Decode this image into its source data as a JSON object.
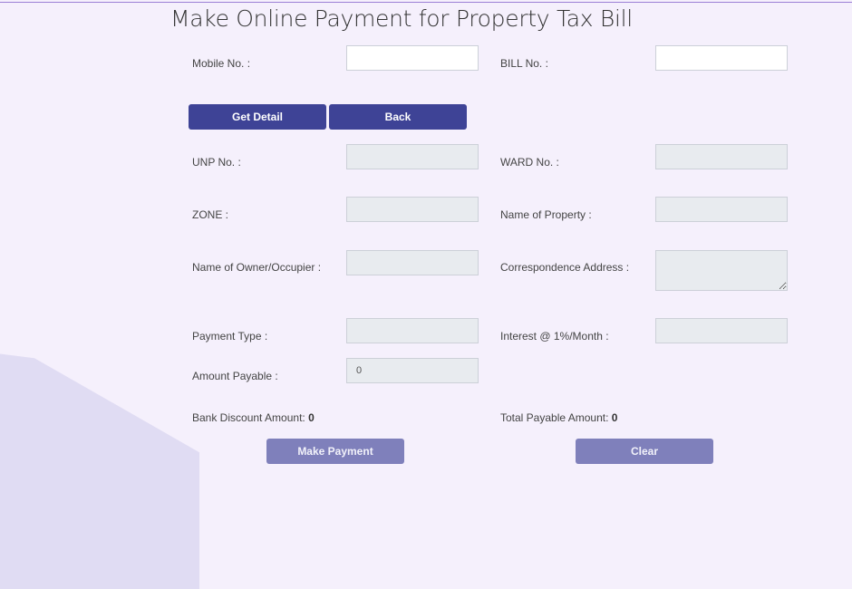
{
  "page": {
    "title": "Make Online Payment for Property Tax Bill"
  },
  "search": {
    "mobile_label": "Mobile No. :",
    "mobile_value": "",
    "bill_label": "BILL No. :",
    "bill_value": "",
    "get_detail_label": "Get Detail",
    "back_label": "Back"
  },
  "details": {
    "unp_label": "UNP No. :",
    "ward_label": "WARD No. :",
    "zone_label": "ZONE :",
    "property_name_label": "Name of Property :",
    "owner_label": "Name of Owner/Occupier :",
    "address_label": "Correspondence Address :",
    "payment_type_label": "Payment Type :",
    "interest_label": "Interest @ 1%/Month :",
    "amount_payable_label": "Amount Payable :",
    "amount_payable_value": "0"
  },
  "summary": {
    "bank_discount_label": "Bank Discount Amount:",
    "bank_discount_value": "0",
    "total_payable_label": "Total Payable Amount:",
    "total_payable_value": "0"
  },
  "actions": {
    "make_payment_label": "Make Payment",
    "clear_label": "Clear"
  },
  "colors": {
    "primary_button": "#3e4396",
    "secondary_button": "#7f80bb",
    "background": "#f5f0fc"
  }
}
